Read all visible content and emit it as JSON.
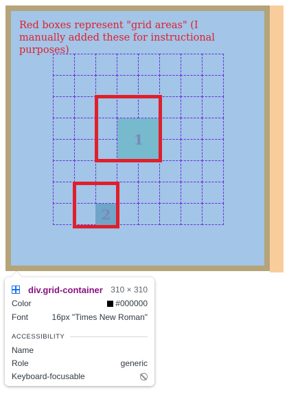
{
  "note": "Red boxes represent \"grid areas\" (I manually added these for instructional purposes)",
  "items": [
    "1",
    "2"
  ],
  "tooltip": {
    "selector": "div.grid-container",
    "size": "310 × 310",
    "color_label": "Color",
    "color_value": "#000000",
    "font_label": "Font",
    "font_value": "16px \"Times New Roman\"",
    "section": "ACCESSIBILITY",
    "name_label": "Name",
    "name_value": "",
    "role_label": "Role",
    "role_value": "generic",
    "keyboard_label": "Keyboard-focusable",
    "keyboard_icon": "not-focusable-icon"
  },
  "colors": {
    "background": "#a2c5e8",
    "frame": "#b5a37a",
    "area_border": "#e01f2b",
    "grid_lines": "#6a2fd6",
    "item1": "#77b9cd",
    "item2": "#6fa5c8",
    "peach": "#f9cd9b"
  }
}
